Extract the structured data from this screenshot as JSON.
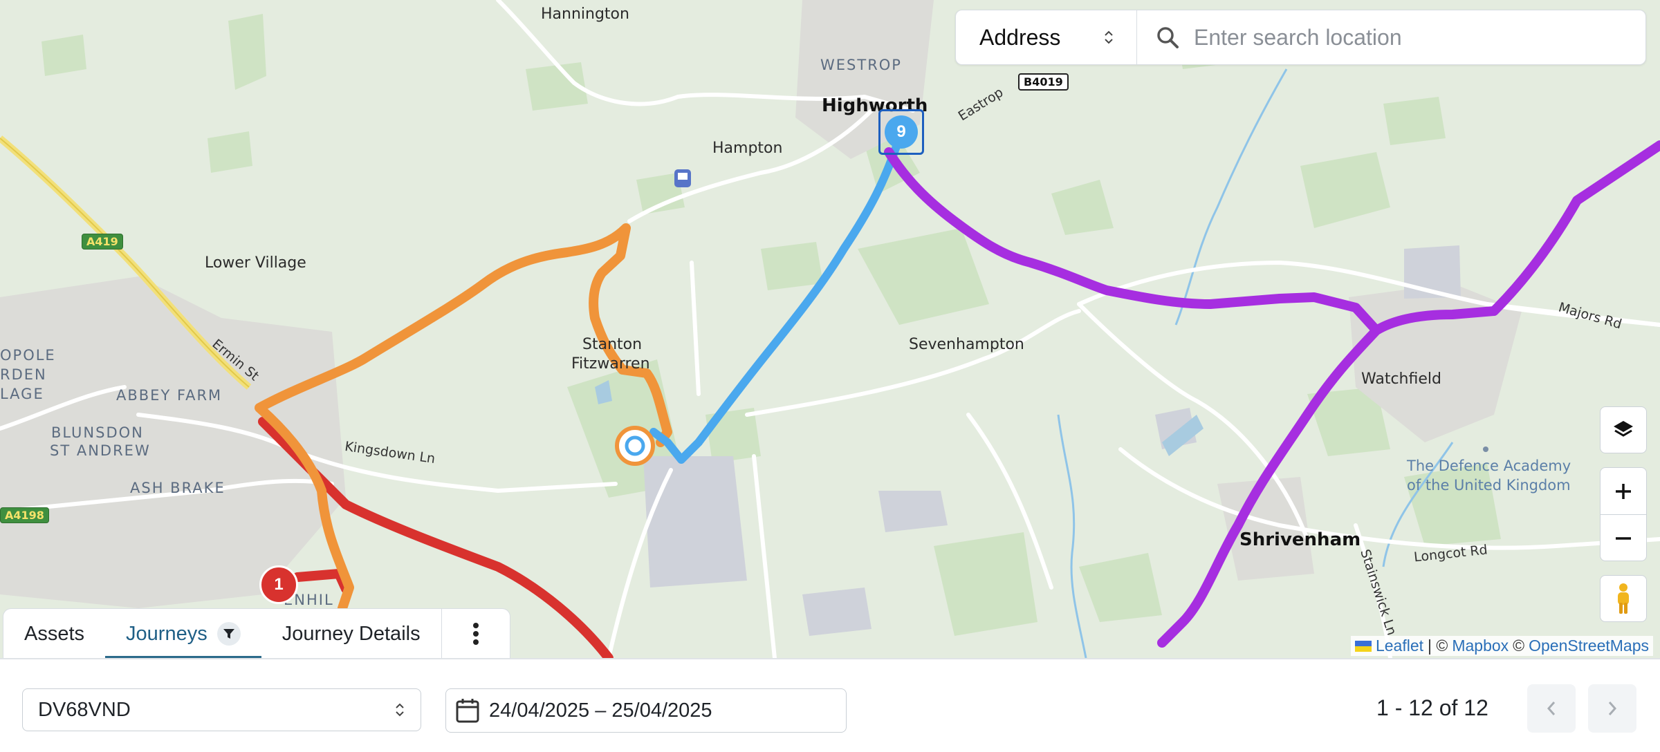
{
  "map": {
    "places": {
      "hannington": "Hannington",
      "westrop": "WESTROP",
      "highworth": "Highworth",
      "hampton": "Hampton",
      "lower_village": "Lower Village",
      "stanton_line1": "Stanton",
      "stanton_line2": "Fitzwarren",
      "sevenhampton": "Sevenhampton",
      "watchfield": "Watchfield",
      "defence_line1": "The Defence Academy",
      "defence_line2": "of the United Kingdom",
      "shrivenham": "Shrivenham",
      "abbey_farm": "ABBEY FARM",
      "blunsdon_line1": "BLUNSDON",
      "blunsdon_line2": "ST ANDREW",
      "ash_brake": "ASH BRAKE",
      "opole_line1": "OPOLE",
      "opole_line2": "RDEN",
      "opole_line3": "LAGE",
      "penhill_partial": "ENHIL"
    },
    "roads": {
      "a419": "A419",
      "a4198": "A4198",
      "b4019": "B4019",
      "eastrop": "Eastrop",
      "ermin_st": "Ermin St",
      "kingsdown_ln": "Kingsdown Ln",
      "majors_rd": "Majors Rd",
      "longcot_rd": "Longcot Rd",
      "stainswick_ln": "Stainswick Ln"
    },
    "markers": {
      "cluster_highworth": "9",
      "cluster_penhill": "1"
    },
    "route_colors": {
      "blue": "#4aa8ee",
      "orange": "#f0943a",
      "red": "#d8322e",
      "purple": "#a62ee0"
    }
  },
  "search": {
    "type_label": "Address",
    "placeholder": "Enter search location"
  },
  "tabs": {
    "assets": "Assets",
    "journeys": "Journeys",
    "journey_details": "Journey Details"
  },
  "attribution": {
    "leaflet": "Leaflet",
    "sep1": "| ©",
    "mapbox": "Mapbox",
    "sep2": "©",
    "osm": "OpenStreetMaps"
  },
  "bottom": {
    "asset": "DV68VND",
    "date_range": "24/04/2025 – 25/04/2025",
    "pager": "1 - 12 of 12"
  }
}
